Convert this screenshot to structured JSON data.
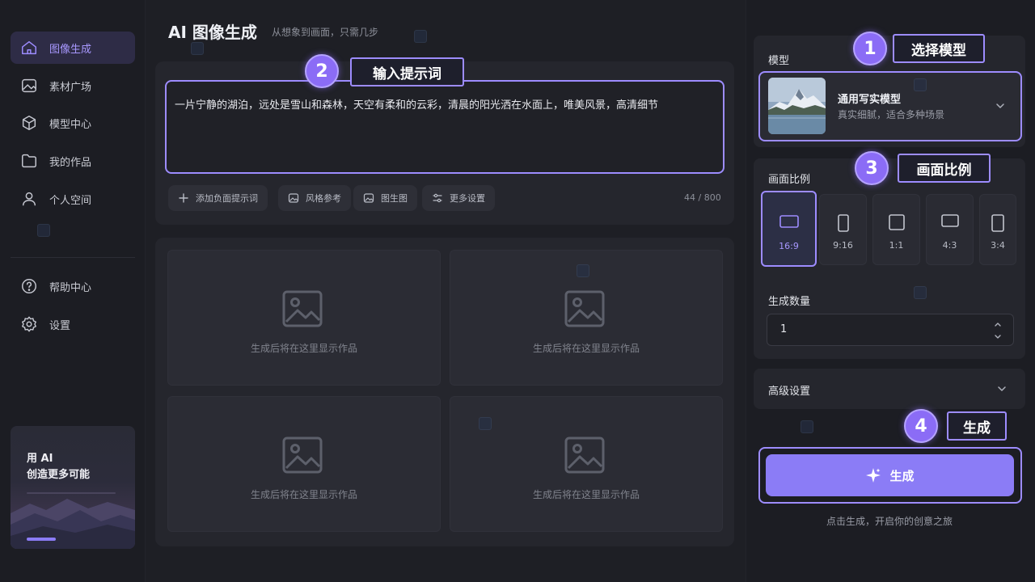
{
  "sidebar": {
    "items": [
      {
        "label": "图像生成",
        "icon": "home-icon",
        "active": true
      },
      {
        "label": "素材广场",
        "icon": "image-icon",
        "active": false
      },
      {
        "label": "模型中心",
        "icon": "cube-icon",
        "active": false
      },
      {
        "label": "我的作品",
        "icon": "folder-icon",
        "active": false
      },
      {
        "label": "个人空间",
        "icon": "user-icon",
        "active": false
      }
    ],
    "bottom_items": [
      {
        "label": "帮助中心",
        "icon": "help-icon"
      },
      {
        "label": "设置",
        "icon": "gear-icon"
      }
    ],
    "promo": {
      "line1": "用 AI",
      "line2": "创造更多可能"
    }
  },
  "main": {
    "title": "AI 图像生成",
    "subtitle": "从想象到画面，只需几步",
    "prompt": {
      "value": "一片宁静的湖泊，远处是雪山和森林，天空有柔和的云彩，清晨的阳光洒在水面上，唯美风景，高清细节",
      "counter": "44 / 800"
    },
    "chips": [
      {
        "label": "添加负面提示词",
        "icon": "plus-icon"
      },
      {
        "label": "风格参考",
        "icon": "image-icon"
      },
      {
        "label": "图生图",
        "icon": "image-icon"
      },
      {
        "label": "更多设置",
        "icon": "sliders-icon"
      }
    ],
    "placeholder_text": "生成后将在这里显示作品"
  },
  "panel": {
    "model": {
      "label": "模型",
      "name": "通用写实模型",
      "desc": "真实细腻，适合多种场景"
    },
    "ratio": {
      "label": "画面比例",
      "options": [
        "16:9",
        "9:16",
        "1:1",
        "4:3",
        "3:4"
      ],
      "selected": "16:9"
    },
    "quantity": {
      "label": "生成数量",
      "value": "1"
    },
    "advanced": {
      "label": "高级设置"
    },
    "generate": {
      "label": "生成",
      "hint": "点击生成，开启你的创意之旅"
    }
  },
  "annotations": [
    {
      "number": "1",
      "text": "选择模型"
    },
    {
      "number": "2",
      "text": "输入提示词"
    },
    {
      "number": "3",
      "text": "画面比例"
    },
    {
      "number": "4",
      "text": "生成"
    }
  ],
  "colors": {
    "accent": "#8b7cf6",
    "highlight_border": "#9d8cff",
    "background": "#1e1f25",
    "card": "#25262d"
  }
}
